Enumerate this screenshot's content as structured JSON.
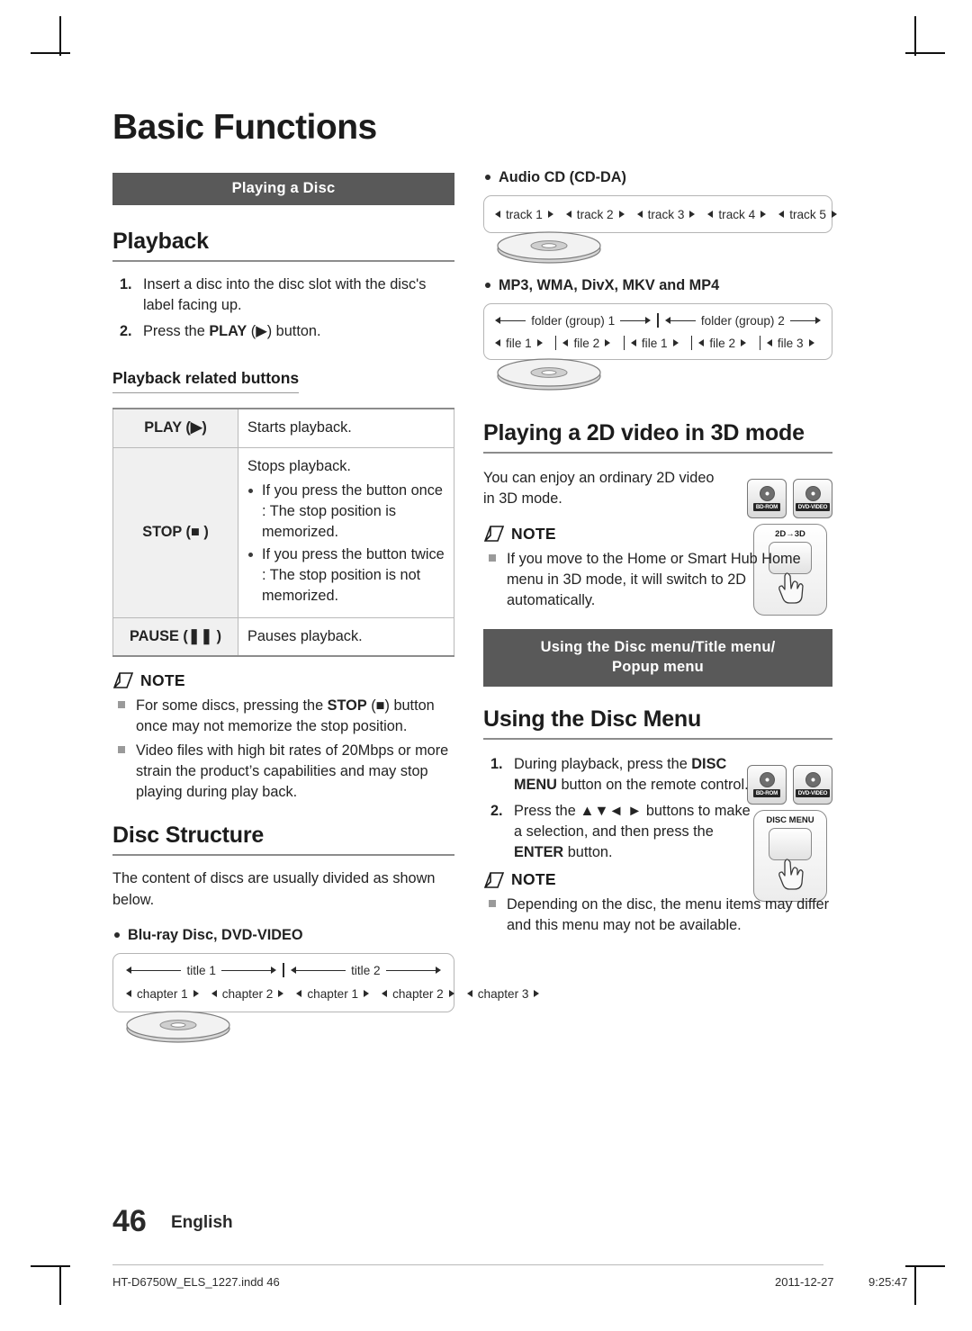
{
  "page": {
    "title": "Basic Functions",
    "number": "46",
    "language": "English",
    "footer_file": "HT-D6750W_ELS_1227.indd   46",
    "footer_date": "2011-12-27",
    "footer_time": "9:25:47"
  },
  "left": {
    "band": "Playing a Disc",
    "playback_heading": "Playback",
    "steps": [
      {
        "num": "1.",
        "text": "Insert a disc into the disc slot with the disc's label facing up."
      },
      {
        "num": "2.",
        "pre": "Press the ",
        "bold": "PLAY",
        "mid": " (",
        "glyph": "▶",
        "post": ") button."
      }
    ],
    "related_heading": "Playback related buttons",
    "table": [
      {
        "key": "PLAY",
        "key_glyph": "▶",
        "desc": "Starts playback."
      },
      {
        "key": "STOP",
        "key_glyph": "■",
        "desc": "Stops playback.",
        "sub": [
          "If you press the button once : The stop position is memorized.",
          "If you press the button twice : The stop position is not memorized."
        ]
      },
      {
        "key": "PAUSE",
        "key_glyph": "❚❚",
        "desc": "Pauses playback."
      }
    ],
    "note_label": "NOTE",
    "notes": [
      {
        "pre": "For some discs, pressing the ",
        "bold": "STOP",
        "mid": " (",
        "glyph": "■",
        "post": ") button once may not memorize the stop position."
      },
      {
        "pre": "Video files with high bit rates of 20Mbps or more strain the product’s capabilities and may stop playing during play back."
      }
    ],
    "disc_structure_heading": "Disc Structure",
    "disc_structure_text": "The content of discs are usually divided as shown below.",
    "bullet_bluray": "Blu-ray Disc, DVD-VIDEO",
    "bluray_diagram": {
      "row1": [
        "title 1",
        "title 2"
      ],
      "row2": [
        "chapter 1",
        "chapter 2",
        "chapter 1",
        "chapter 2",
        "chapter 3"
      ]
    }
  },
  "right": {
    "bullet_audiocd": "Audio CD (CD-DA)",
    "audiocd_tracks": [
      "track 1",
      "track 2",
      "track 3",
      "track 4",
      "track 5"
    ],
    "bullet_mp3": "MP3, WMA, DivX, MKV and MP4",
    "mp3_folders": [
      "folder (group) 1",
      "folder (group) 2"
    ],
    "mp3_files": [
      "file 1",
      "file 2",
      "file 1",
      "file 2",
      "file 3"
    ],
    "heading_2d3d": "Playing a 2D video in 3D mode",
    "text_2d3d": "You can enjoy an ordinary 2D video in 3D mode.",
    "remote_2d3d_caption": "2D→3D",
    "logos_2d3d": [
      "BD-ROM",
      "DVD-VIDEO"
    ],
    "note_label": "NOTE",
    "notes_2d3d": [
      "If you move to the Home or Smart Hub Home menu in 3D mode, it will switch to 2D automatically."
    ],
    "band_line1": "Using the Disc menu/Title menu/",
    "band_line2": "Popup menu",
    "heading_discmenu": "Using the Disc Menu",
    "logos_discmenu": [
      "BD-ROM",
      "DVD-VIDEO"
    ],
    "remote_discmenu_caption": "DISC MENU",
    "steps_discmenu": [
      {
        "num": "1.",
        "pre": "During playback, press the ",
        "bold": "DISC MENU",
        "post": "  button on the remote control."
      },
      {
        "num": "2.",
        "pre": "Press the ",
        "glyphs": "▲▼◄ ►",
        "mid": " buttons to make a selection, and then press the ",
        "bold2": "ENTER",
        "post": " button."
      }
    ],
    "notes_discmenu": [
      "Depending on the disc, the menu items may differ and this menu may not be available."
    ]
  }
}
